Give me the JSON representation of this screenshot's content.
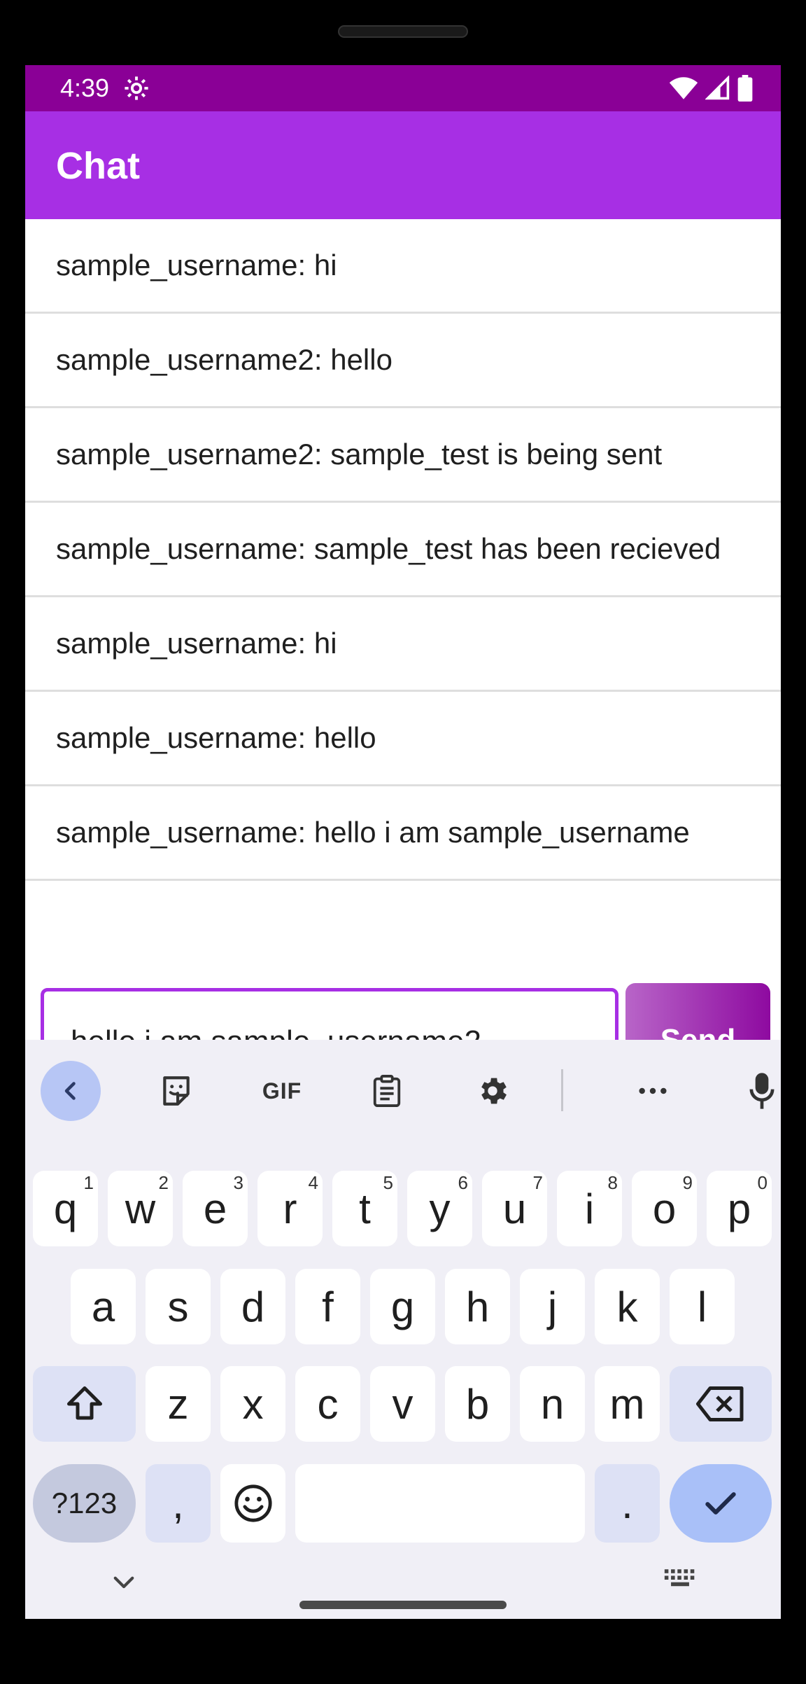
{
  "status_bar": {
    "time": "4:39"
  },
  "app_bar": {
    "title": "Chat"
  },
  "messages": [
    {
      "text": "sample_username: hi"
    },
    {
      "text": "sample_username2: hello"
    },
    {
      "text": "sample_username2: sample_test is being sent"
    },
    {
      "text": "sample_username: sample_test has been recieved"
    },
    {
      "text": "sample_username: hi"
    },
    {
      "text": "sample_username: hello"
    },
    {
      "text": "sample_username: hello i am sample_username"
    }
  ],
  "compose": {
    "input_value": "hello i am sample_username2",
    "send_label": "Send"
  },
  "keyboard": {
    "toolbar": {
      "gif_label": "GIF",
      "icons": [
        "back-chevron-icon",
        "sticker-icon",
        "gif-icon",
        "clipboard-icon",
        "settings-gear-icon",
        "more-icon",
        "microphone-icon"
      ]
    },
    "row1": [
      {
        "key": "q",
        "hint": "1"
      },
      {
        "key": "w",
        "hint": "2"
      },
      {
        "key": "e",
        "hint": "3"
      },
      {
        "key": "r",
        "hint": "4"
      },
      {
        "key": "t",
        "hint": "5"
      },
      {
        "key": "y",
        "hint": "6"
      },
      {
        "key": "u",
        "hint": "7"
      },
      {
        "key": "i",
        "hint": "8"
      },
      {
        "key": "o",
        "hint": "9"
      },
      {
        "key": "p",
        "hint": "0"
      }
    ],
    "row2": [
      "a",
      "s",
      "d",
      "f",
      "g",
      "h",
      "j",
      "k",
      "l"
    ],
    "row3": [
      "z",
      "x",
      "c",
      "v",
      "b",
      "n",
      "m"
    ],
    "row4": {
      "symbols": "?123",
      "comma": ",",
      "period": "."
    }
  },
  "colors": {
    "status_bar": "#8a0096",
    "app_bar": "#a72fe4",
    "accent": "#a72fe4",
    "keyboard_bg": "#f0eff6",
    "enter_key": "#a9c0f8"
  }
}
